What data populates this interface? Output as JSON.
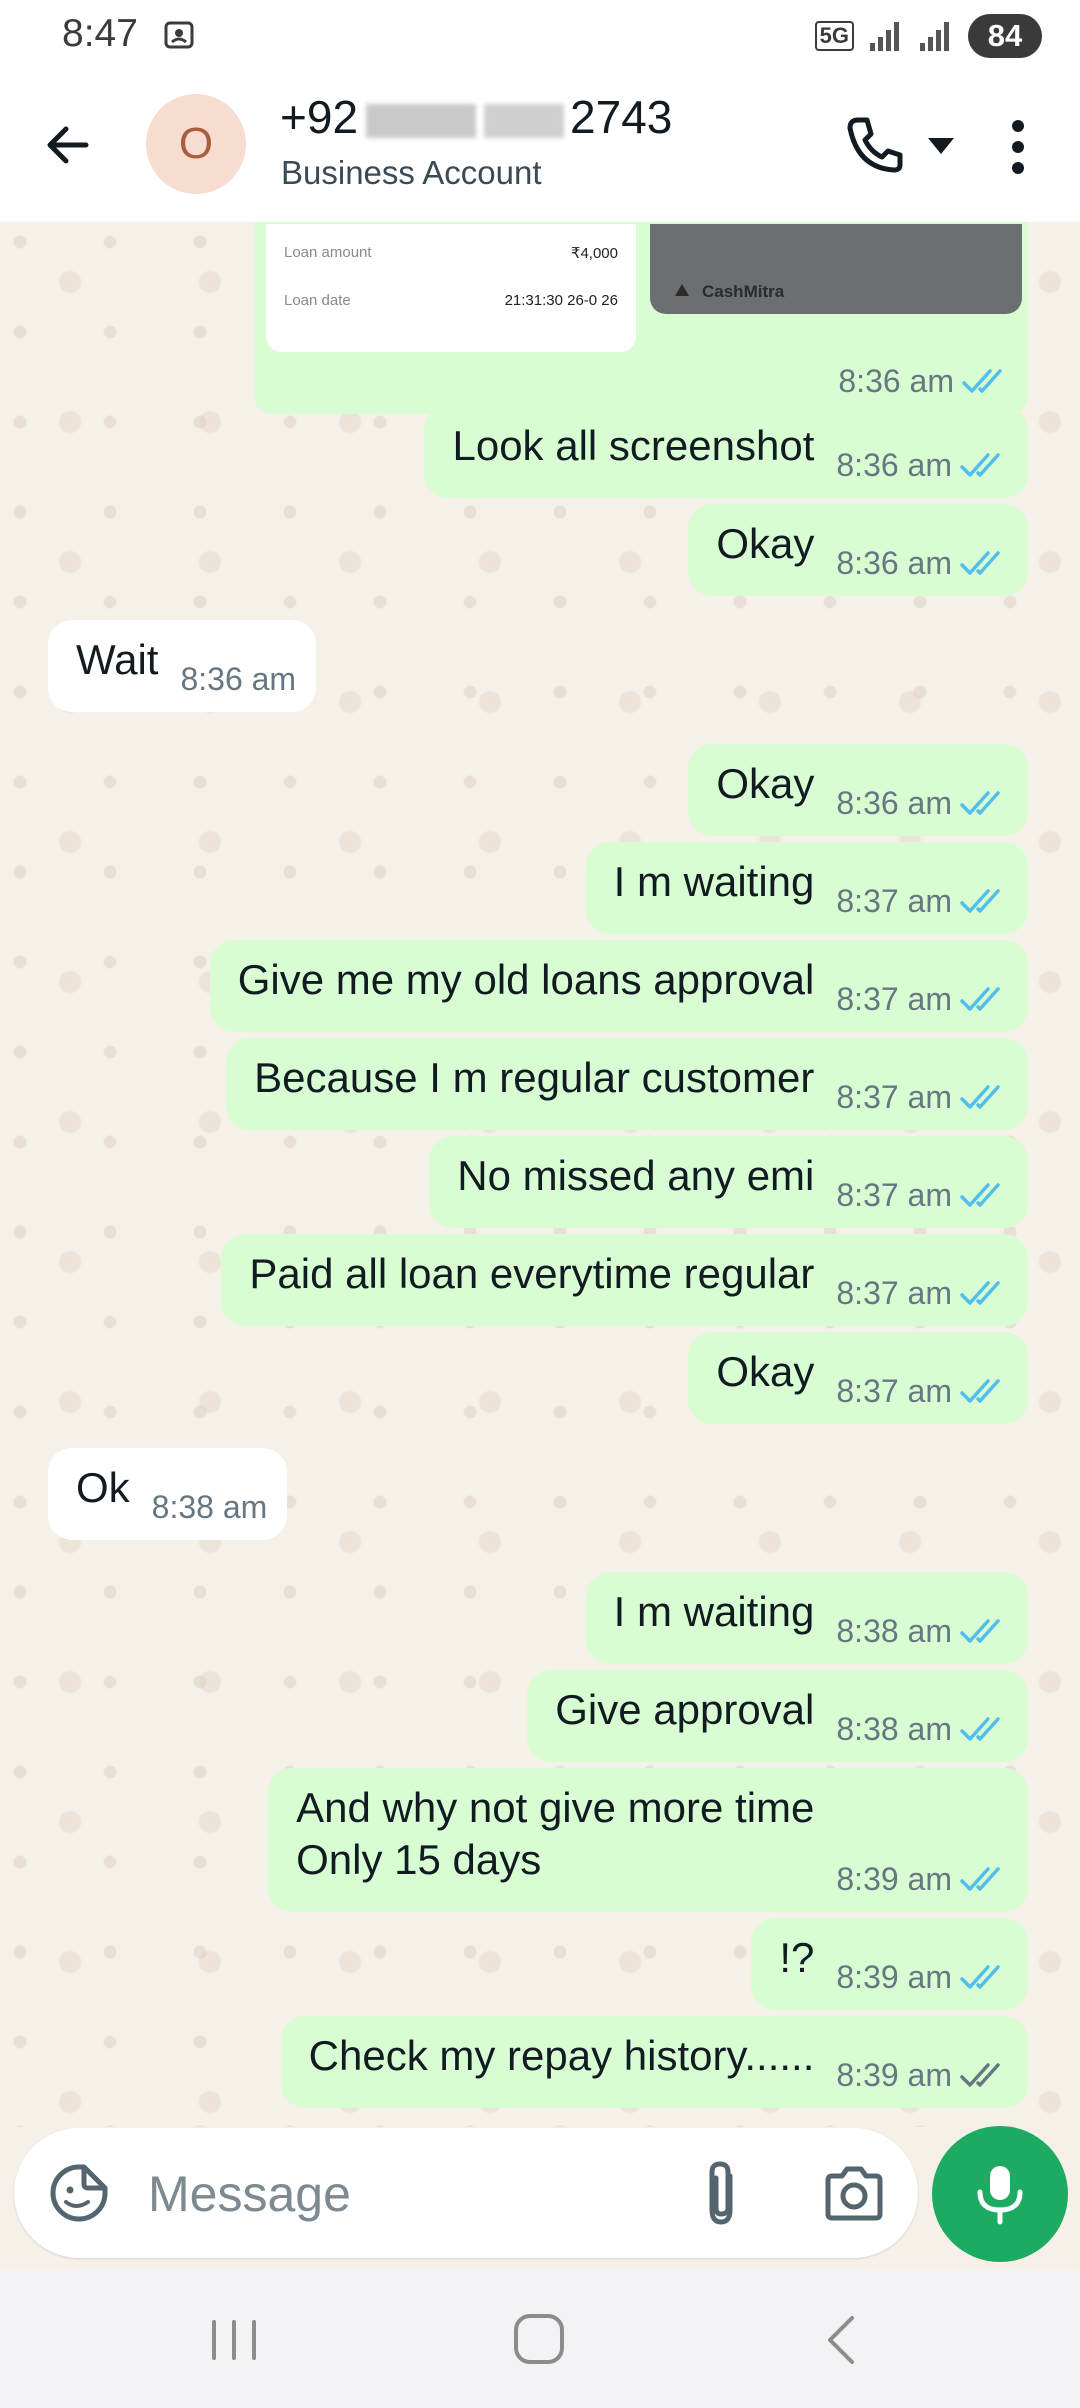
{
  "status_bar": {
    "time": "8:47",
    "network": "5G",
    "battery": "84"
  },
  "header": {
    "name_prefix": "+92",
    "name_suffix": "2743",
    "subtitle": "Business Account"
  },
  "top_image": {
    "loan_amount_label": "Loan amount",
    "loan_amount_value": "₹4,000",
    "loan_date_label": "Loan date",
    "loan_date_value": "21:31:30 26-0   26",
    "brand": "CashMitra",
    "time": "8:36 am"
  },
  "messages": [
    {
      "dir": "out",
      "text": "Look all screenshot",
      "time": "8:36 am",
      "read": true
    },
    {
      "dir": "out",
      "text": "Okay",
      "time": "8:36 am",
      "read": true
    },
    {
      "dir": "in",
      "text": "Wait",
      "time": "8:36 am"
    },
    {
      "dir": "out",
      "text": "Okay",
      "time": "8:36 am",
      "read": true
    },
    {
      "dir": "out",
      "text": "I m waiting",
      "time": "8:37 am",
      "read": true
    },
    {
      "dir": "out",
      "text": "Give me my old loans approval",
      "time": "8:37 am",
      "read": true
    },
    {
      "dir": "out",
      "text": "Because I m regular customer",
      "time": "8:37 am",
      "read": true
    },
    {
      "dir": "out",
      "text": "No missed any emi",
      "time": "8:37 am",
      "read": true
    },
    {
      "dir": "out",
      "text": "Paid all loan everytime regular",
      "time": "8:37 am",
      "read": true
    },
    {
      "dir": "out",
      "text": "Okay",
      "time": "8:37 am",
      "read": true
    },
    {
      "dir": "in",
      "text": "Ok",
      "time": "8:38 am"
    },
    {
      "dir": "out",
      "text": "I m waiting",
      "time": "8:38 am",
      "read": true
    },
    {
      "dir": "out",
      "text": "Give approval",
      "time": "8:38 am",
      "read": true
    },
    {
      "dir": "out",
      "text": "And why not give more time\nOnly 15 days",
      "time": "8:39 am",
      "read": true
    },
    {
      "dir": "out",
      "text": "!?",
      "time": "8:39 am",
      "read": true
    },
    {
      "dir": "out",
      "text": "Check my repay history......",
      "time": "8:39 am",
      "read": false
    }
  ],
  "input": {
    "placeholder": "Message"
  },
  "colors": {
    "bubble_out": "#d9fdd3",
    "bubble_in": "#ffffff",
    "tick_read": "#53bdeb",
    "tick_sent": "#667781",
    "mic": "#1daa61"
  }
}
